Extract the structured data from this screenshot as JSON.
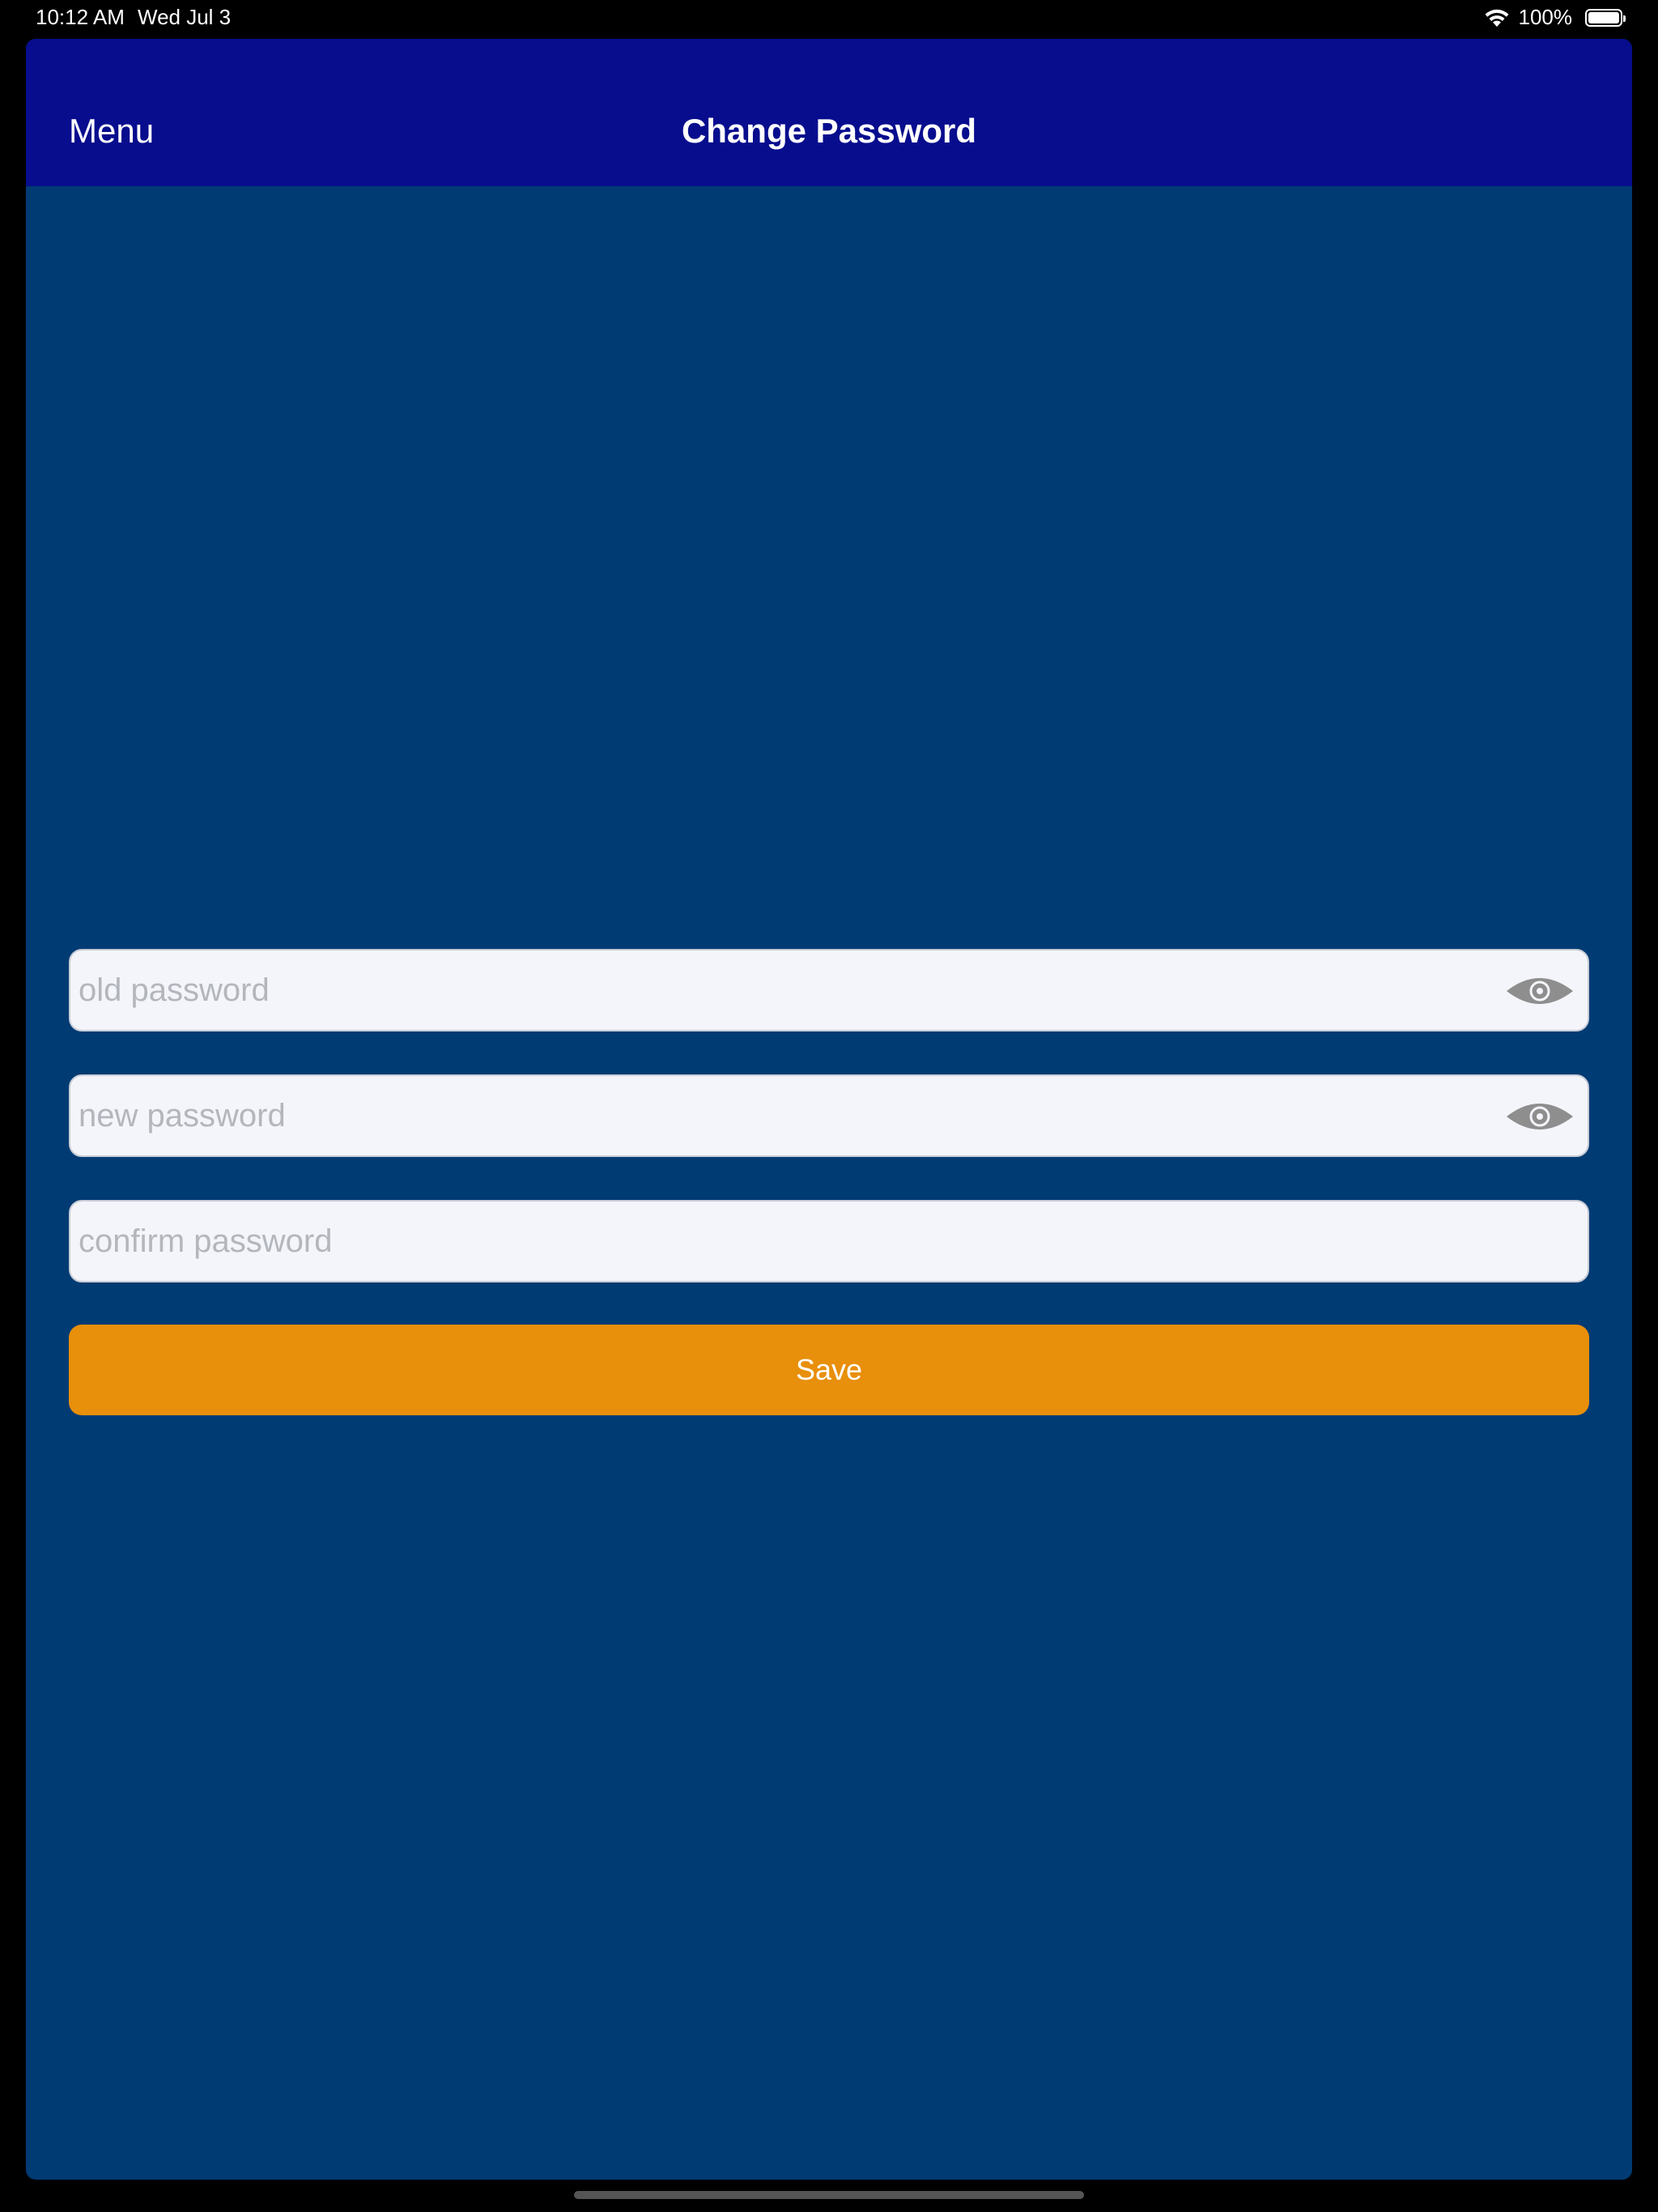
{
  "status_bar": {
    "time": "10:12 AM",
    "date": "Wed Jul 3",
    "battery_percent": "100%",
    "icons": [
      "wifi-icon",
      "battery-icon"
    ]
  },
  "nav": {
    "menu_label": "Menu",
    "title": "Change Password",
    "background_color": "#070d8d"
  },
  "form": {
    "old_password": {
      "value": "",
      "placeholder": "old password",
      "icon": "eye-icon"
    },
    "new_password": {
      "value": "",
      "placeholder": "new password",
      "icon": "eye-icon"
    },
    "confirm_password": {
      "value": "",
      "placeholder": "confirm password"
    },
    "save_label": "Save"
  },
  "colors": {
    "background": "#003b73",
    "accent": "#e88f0b",
    "field_background": "#f4f5fa"
  }
}
